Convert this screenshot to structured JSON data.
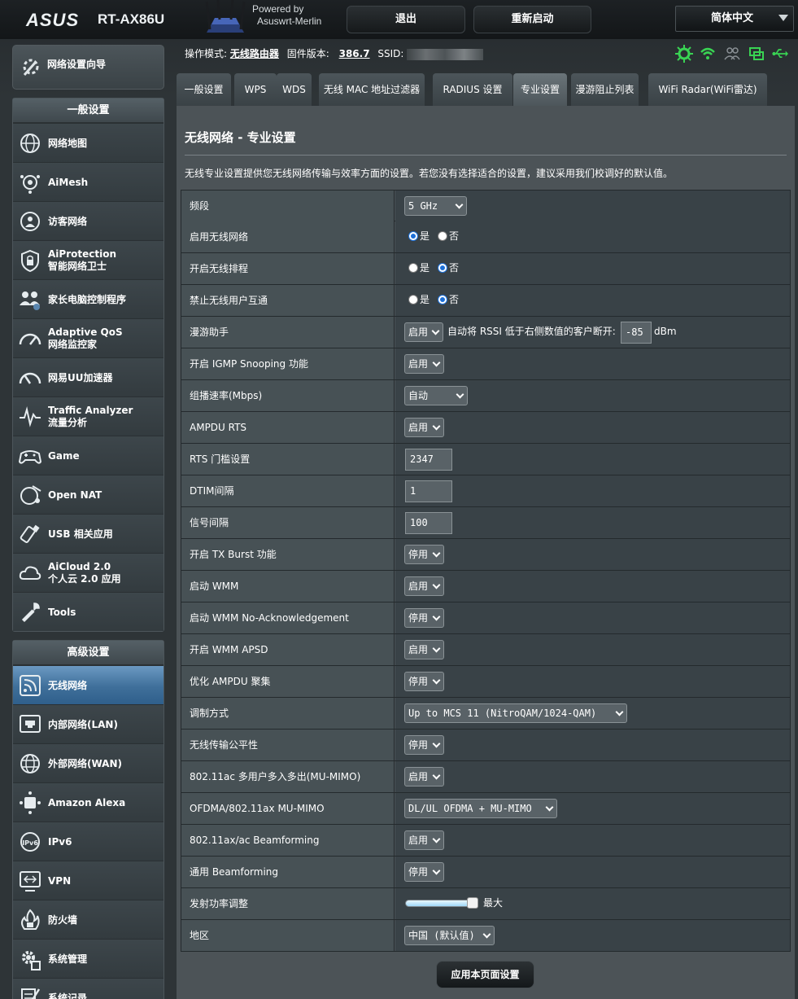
{
  "header": {
    "brand": "ASUS",
    "model": "RT-AX86U",
    "powered_line1": "Powered by",
    "powered_line2": "Asuswrt-Merlin",
    "logout": "退出",
    "reboot": "重新启动",
    "language": "简体中文"
  },
  "sidebar": {
    "wizard": "网络设置向导",
    "general_title": "一般设置",
    "general": [
      {
        "l1": "网络地图",
        "icon": "network-map-icon"
      },
      {
        "l1": "AiMesh",
        "icon": "aimesh-icon"
      },
      {
        "l1": "访客网络",
        "icon": "guest-network-icon"
      },
      {
        "l1": "AiProtection",
        "l2": "智能网络卫士",
        "icon": "aiprotection-icon"
      },
      {
        "l1": "家长电脑控制程序",
        "icon": "parental-control-icon"
      },
      {
        "l1": "Adaptive QoS",
        "l2": "网络监控家",
        "icon": "qos-gauge-icon"
      },
      {
        "l1": "网易UU加速器",
        "icon": "uu-accelerator-icon"
      },
      {
        "l1": "Traffic Analyzer",
        "l2": "流量分析",
        "icon": "traffic-analyzer-icon"
      },
      {
        "l1": "Game",
        "icon": "gamepad-icon"
      },
      {
        "l1": "Open NAT",
        "icon": "open-nat-icon"
      },
      {
        "l1": "USB 相关应用",
        "icon": "usb-icon"
      },
      {
        "l1": "AiCloud 2.0",
        "l2": "个人云 2.0 应用",
        "icon": "aicloud-icon"
      },
      {
        "l1": "Tools",
        "icon": "wrench-icon"
      }
    ],
    "advanced_title": "高级设置",
    "advanced": [
      {
        "l1": "无线网络",
        "icon": "wireless-icon"
      },
      {
        "l1": "内部网络(LAN)",
        "icon": "lan-icon"
      },
      {
        "l1": "外部网络(WAN)",
        "icon": "wan-globe-icon"
      },
      {
        "l1": "Amazon Alexa",
        "icon": "alexa-icon"
      },
      {
        "l1": "IPv6",
        "icon": "ipv6-icon"
      },
      {
        "l1": "VPN",
        "icon": "vpn-icon"
      },
      {
        "l1": "防火墙",
        "icon": "firewall-icon"
      },
      {
        "l1": "系统管理",
        "icon": "admin-gear-icon"
      },
      {
        "l1": "系统记录",
        "icon": "system-log-icon"
      }
    ]
  },
  "status": {
    "op_label": "操作模式:",
    "op_value": "无线路由器",
    "fw_label": "固件版本:",
    "fw_value": "386.7",
    "ssid_label": "SSID:"
  },
  "tabs": [
    "一般设置",
    "WPS",
    "WDS",
    "无线 MAC 地址过滤器",
    "RADIUS 设置",
    "专业设置",
    "漫游阻止列表",
    "WiFi Radar(WiFi雷达)"
  ],
  "content": {
    "title": "无线网络 - 专业设置",
    "desc": "无线专业设置提供您无线网络传输与效率方面的设置。若您没有选择适合的设置，建议采用我们校调好的默认值。",
    "yes": "是",
    "no": "否",
    "rows": [
      {
        "label": "频段",
        "value": "5 GHz"
      },
      {
        "label": "启用无线网络"
      },
      {
        "label": "开启无线排程"
      },
      {
        "label": "禁止无线用户互通"
      },
      {
        "label": "漫游助手",
        "value": "启用",
        "extra": "自动将 RSSI 低于右侧数值的客户断开:",
        "input": "-85",
        "unit": "dBm"
      },
      {
        "label": "开启 IGMP Snooping 功能",
        "value": "启用"
      },
      {
        "label": "组播速率(Mbps)",
        "value": "自动"
      },
      {
        "label": "AMPDU RTS",
        "value": "启用"
      },
      {
        "label": "RTS 门槛设置",
        "input": "2347"
      },
      {
        "label": "DTIM间隔",
        "input": "1"
      },
      {
        "label": "信号间隔",
        "input": "100"
      },
      {
        "label": "开启 TX Burst 功能",
        "value": "停用"
      },
      {
        "label": "启动 WMM",
        "value": "启用"
      },
      {
        "label": "启动 WMM No-Acknowledgement",
        "value": "停用"
      },
      {
        "label": "开启 WMM APSD",
        "value": "启用"
      },
      {
        "label": "优化 AMPDU 聚集",
        "value": "停用"
      },
      {
        "label": "调制方式",
        "value": "Up to MCS 11 (NitroQAM/1024-QAM)"
      },
      {
        "label": "无线传输公平性",
        "value": "停用"
      },
      {
        "label": "802.11ac 多用户多入多出(MU-MIMO)",
        "value": "启用"
      },
      {
        "label": "OFDMA/802.11ax MU-MIMO",
        "value": "DL/UL OFDMA + MU-MIMO"
      },
      {
        "label": "802.11ax/ac Beamforming",
        "value": "启用"
      },
      {
        "label": "通用 Beamforming",
        "value": "停用"
      },
      {
        "label": "发射功率调整",
        "value": "最大",
        "level": 1.0
      },
      {
        "label": "地区",
        "value": "中国 (默认值)"
      }
    ],
    "apply": "应用本页面设置"
  },
  "colors": {
    "accent": "#1b6fd8",
    "status_green": "#39d353",
    "active_nav": "#4a7aa6"
  }
}
